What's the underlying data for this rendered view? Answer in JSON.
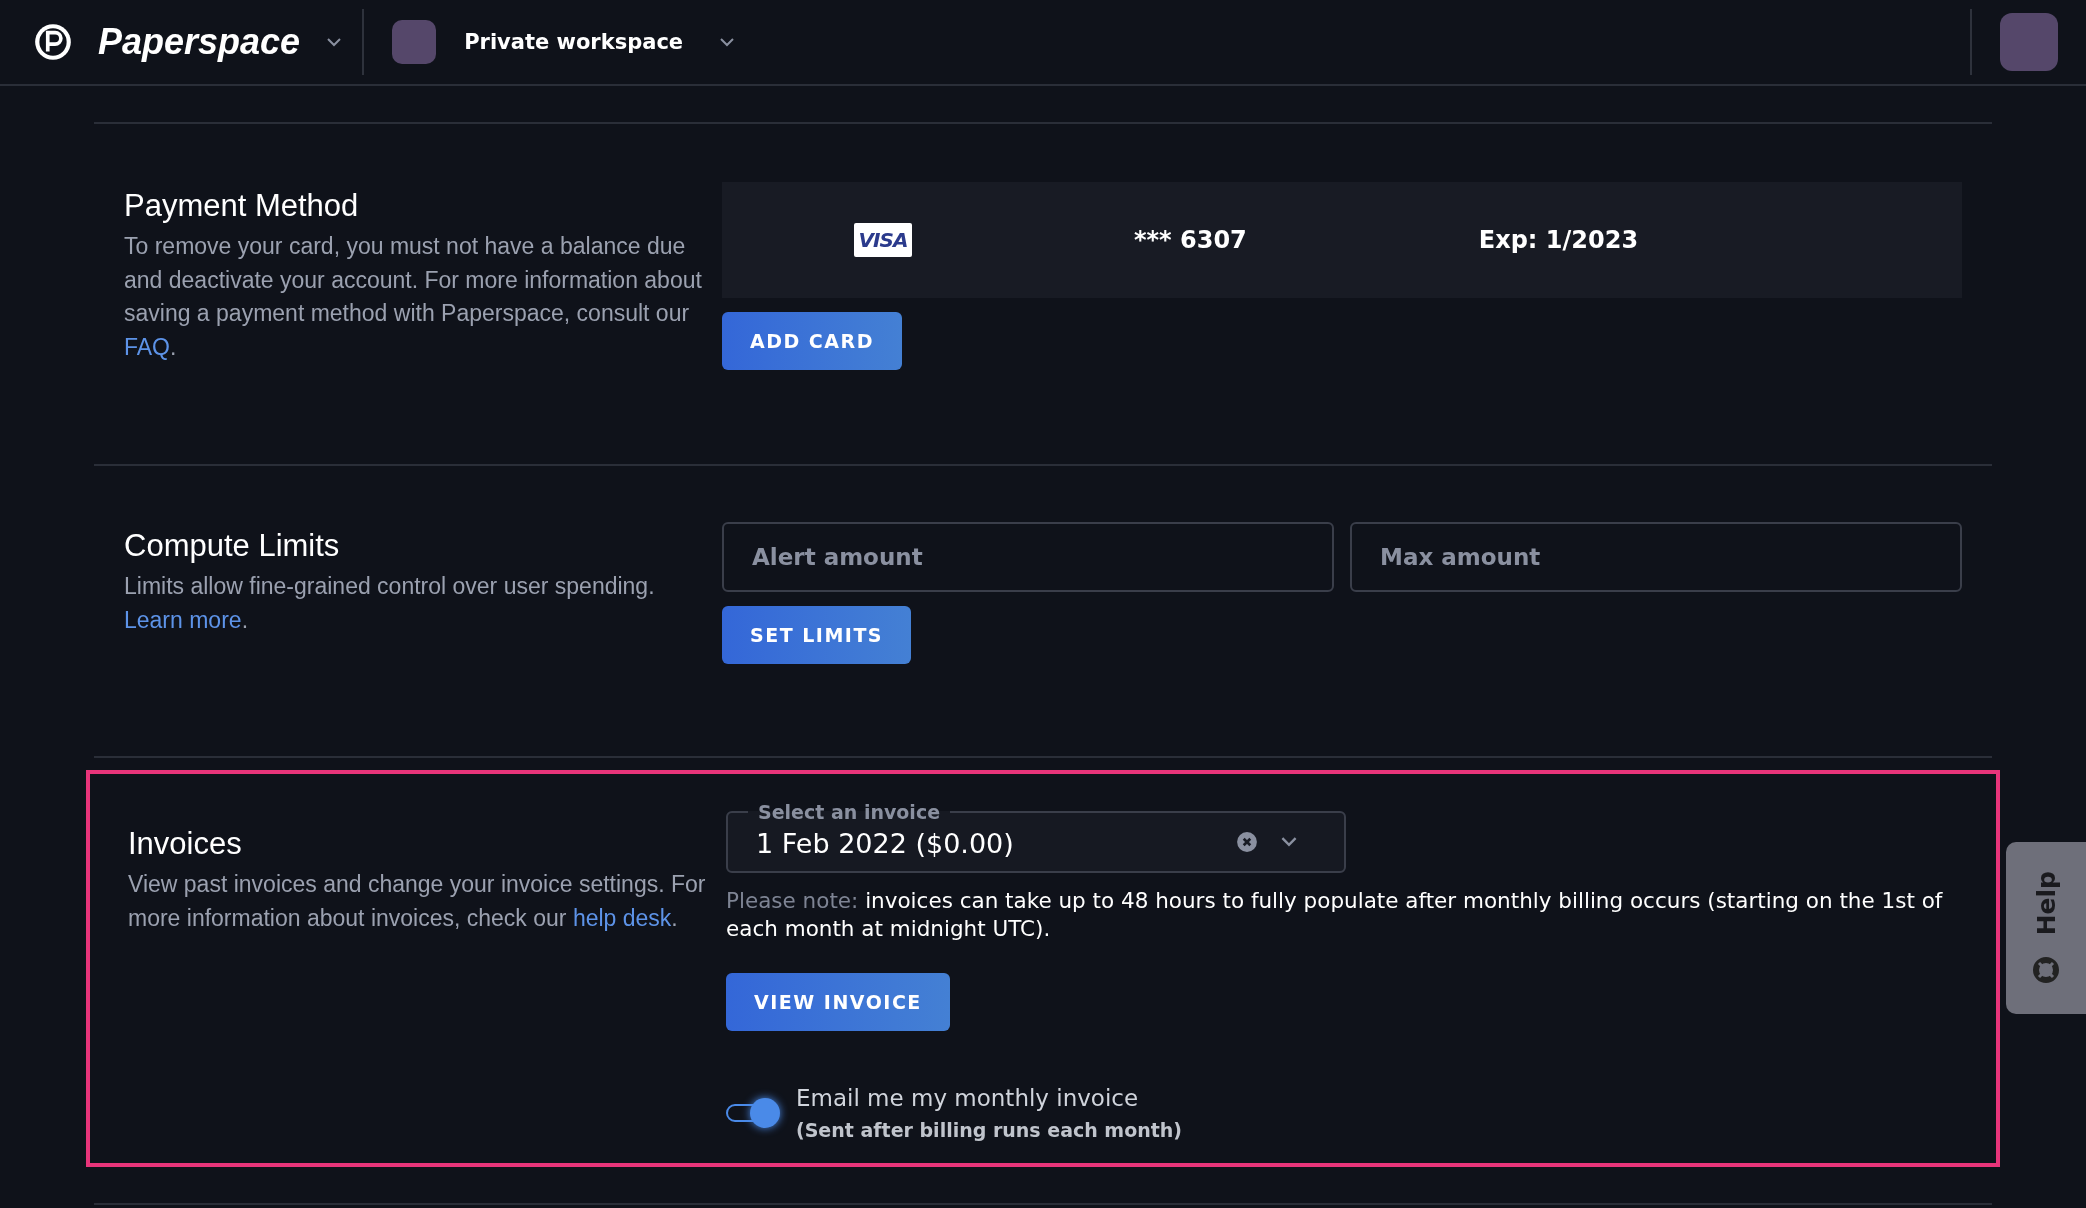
{
  "header": {
    "brand": "Paperspace",
    "workspace": "Private workspace"
  },
  "payment": {
    "title": "Payment Method",
    "description": {
      "before": "To remove your card, you must not have a balance due and deactivate your account. For more information about saving a payment method with Paperspace, consult our ",
      "link": "FAQ",
      "after": "."
    },
    "card": {
      "brand_label": "VISA",
      "number": "*** 6307",
      "expiry": "Exp: 1/2023"
    },
    "button": "ADD CARD"
  },
  "limits": {
    "title": "Compute Limits",
    "description": {
      "before": "Limits allow fine-grained control over user spending. ",
      "link": "Learn more",
      "after": "."
    },
    "fields": [
      {
        "placeholder": "Alert amount"
      },
      {
        "placeholder": "Max amount"
      }
    ],
    "button": "SET LIMITS"
  },
  "invoices": {
    "highlighted": true,
    "title": "Invoices",
    "description": {
      "before": "View past invoices and change your invoice settings. For more information about invoices, check our ",
      "link": "help desk",
      "after": "."
    },
    "select": {
      "label": "Select an invoice",
      "value": "1 Feb 2022 ($0.00)"
    },
    "note": {
      "label": "Please note:",
      "text": "invoices can take up to 48 hours to fully populate after monthly billing occurs (starting on the 1st of each month at midnight UTC)."
    },
    "button": "VIEW INVOICE",
    "email_toggle": {
      "on": true,
      "label": "Email me my monthly invoice",
      "sublabel": "(Sent after billing runs each month)"
    }
  },
  "help_tab": {
    "label": "Help"
  }
}
